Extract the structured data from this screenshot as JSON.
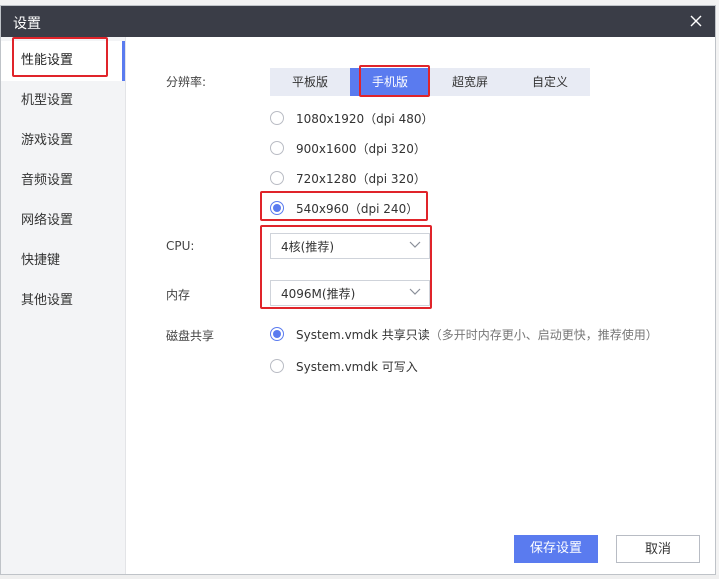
{
  "dialog": {
    "title": "设置"
  },
  "sidebar": {
    "items": [
      {
        "label": "性能设置"
      },
      {
        "label": "机型设置"
      },
      {
        "label": "游戏设置"
      },
      {
        "label": "音频设置"
      },
      {
        "label": "网络设置"
      },
      {
        "label": "快捷键"
      },
      {
        "label": "其他设置"
      }
    ],
    "active_index": 0
  },
  "resolution": {
    "label": "分辨率:",
    "tabs": [
      "平板版",
      "手机版",
      "超宽屏",
      "自定义"
    ],
    "selected_tab": "手机版",
    "options": [
      "1080x1920（dpi 480）",
      "900x1600（dpi 320）",
      "720x1280（dpi 320）",
      "540x960（dpi 240）"
    ],
    "selected_option": "540x960（dpi 240）"
  },
  "cpu": {
    "label": "CPU:",
    "value": "4核(推荐)"
  },
  "memory": {
    "label": "内存",
    "value": "4096M(推荐)"
  },
  "disk": {
    "label": "磁盘共享",
    "option_readonly": "System.vmdk 共享只读",
    "option_readonly_note": "（多开时内存更小、启动更快，推荐使用）",
    "option_writable": "System.vmdk 可写入",
    "selected": "readonly"
  },
  "footer": {
    "save_label": "保存设置",
    "cancel_label": "取消"
  },
  "colors": {
    "accent": "#5a7bef",
    "titlebar": "#3a3d47",
    "highlight": "#e0242a"
  }
}
